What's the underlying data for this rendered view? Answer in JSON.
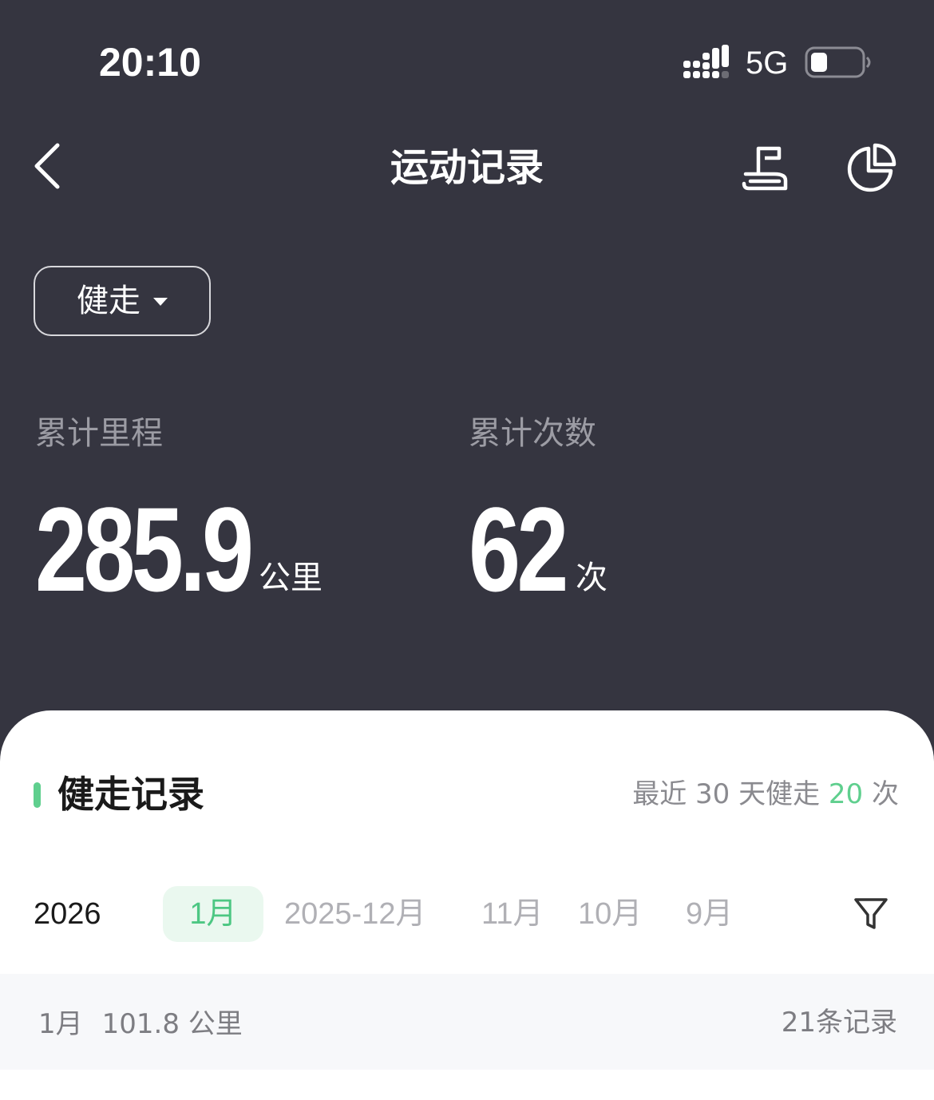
{
  "status_bar": {
    "time": "20:10",
    "network": "5G"
  },
  "nav": {
    "title": "运动记录"
  },
  "filter": {
    "sport_type": "健走"
  },
  "stats": {
    "distance": {
      "label": "累计里程",
      "value": "285.9",
      "unit": "公里"
    },
    "count": {
      "label": "累计次数",
      "value": "62",
      "unit": "次"
    }
  },
  "records": {
    "title": "健走记录",
    "recent_prefix": "最近 30 天健走 ",
    "recent_count": "20",
    "recent_suffix": " 次",
    "year": "2026",
    "months": [
      {
        "label": "1月",
        "active": true
      },
      {
        "label": "2025-12月",
        "active": false
      },
      {
        "label": "11月",
        "active": false
      },
      {
        "label": "10月",
        "active": false
      },
      {
        "label": "9月",
        "active": false
      }
    ],
    "month_summary": {
      "month": "1月",
      "distance": "101.8 公里",
      "count": "21条记录"
    }
  },
  "colors": {
    "accent": "#5fcf8e",
    "header_bg": "#353540"
  }
}
